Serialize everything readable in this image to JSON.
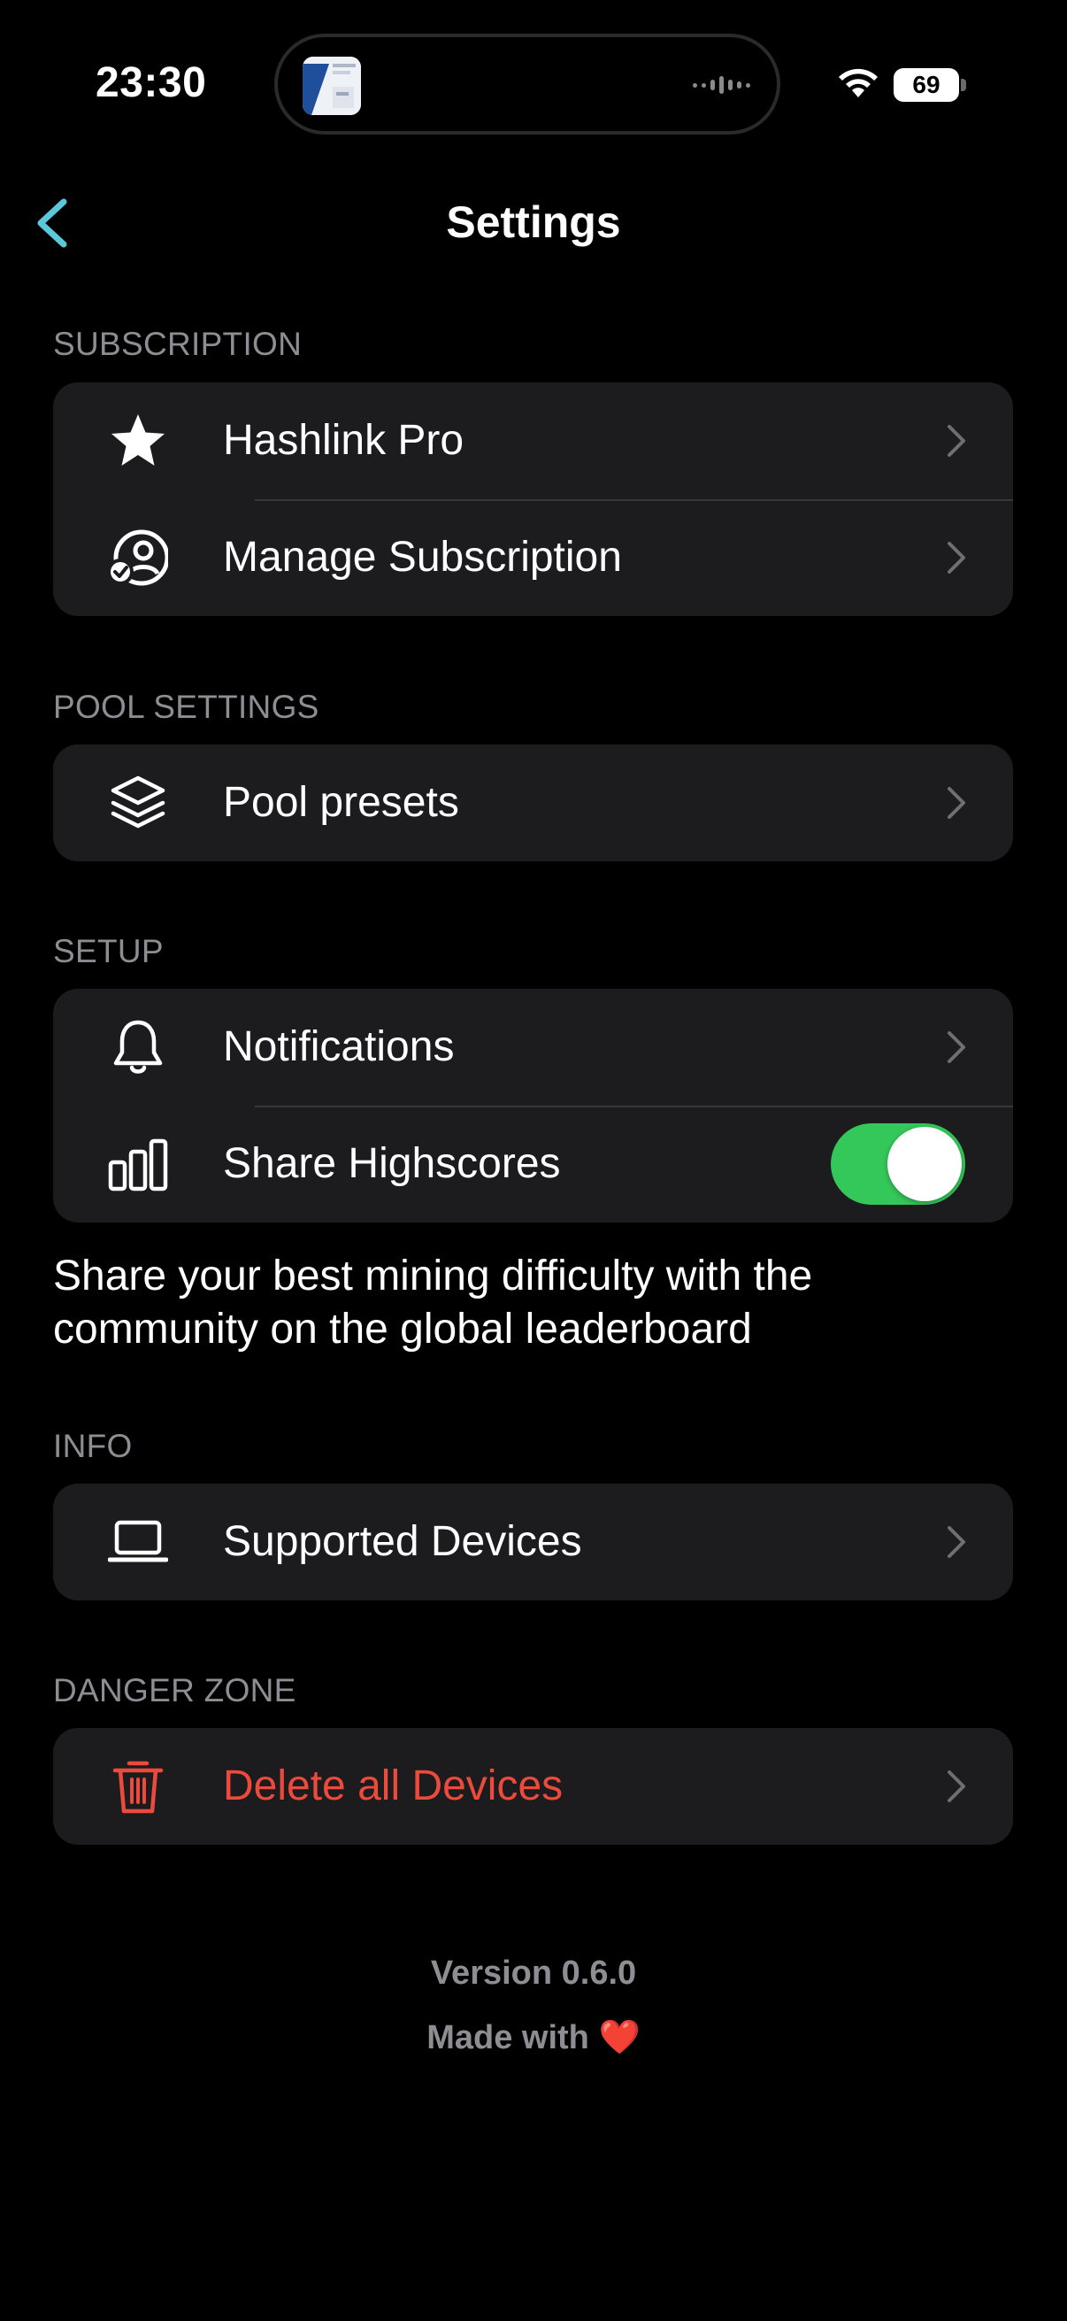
{
  "status_bar": {
    "time": "23:30",
    "battery": "69"
  },
  "nav": {
    "title": "Settings"
  },
  "sections": {
    "subscription": {
      "header": "SUBSCRIPTION",
      "items": [
        {
          "label": "Hashlink Pro",
          "icon": "star-icon"
        },
        {
          "label": "Manage Subscription",
          "icon": "person-checkmark-icon"
        }
      ]
    },
    "pool_settings": {
      "header": "POOL SETTINGS",
      "items": [
        {
          "label": "Pool presets",
          "icon": "layers-icon"
        }
      ]
    },
    "setup": {
      "header": "SETUP",
      "items": [
        {
          "label": "Notifications",
          "icon": "bell-icon"
        },
        {
          "label": "Share Highscores",
          "icon": "bar-chart-icon",
          "toggle_on": true
        }
      ],
      "footer": "Share your best mining difficulty with the community on the global leaderboard"
    },
    "info": {
      "header": "INFO",
      "items": [
        {
          "label": "Supported Devices",
          "icon": "laptop-icon"
        }
      ]
    },
    "danger_zone": {
      "header": "DANGER ZONE",
      "items": [
        {
          "label": "Delete all Devices",
          "icon": "trash-icon"
        }
      ]
    }
  },
  "footer": {
    "version": "Version 0.6.0",
    "made_with": "Made with",
    "heart": "❤️"
  },
  "colors": {
    "accent": "#5ac8d8",
    "danger": "#eb4a3c",
    "toggle_on": "#34c759"
  }
}
